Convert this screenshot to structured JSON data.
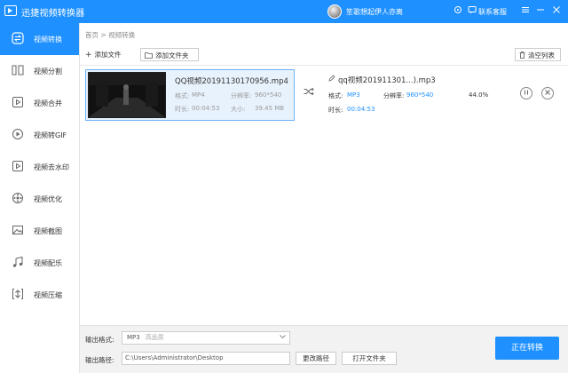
{
  "app": {
    "title": "迅捷视频转换器",
    "username": "笙歌想起伊人亦离",
    "support": "联系客服"
  },
  "titlebar_icons": [
    "skin-icon",
    "menu-icon",
    "minimize-icon",
    "close-icon"
  ],
  "sidebar": {
    "items": [
      {
        "label": "视频转换",
        "icon": "convert-icon",
        "active": true
      },
      {
        "label": "视频分割",
        "icon": "split-icon"
      },
      {
        "label": "视频合并",
        "icon": "merge-icon"
      },
      {
        "label": "视频转GIF",
        "icon": "gif-icon"
      },
      {
        "label": "视频去水印",
        "icon": "watermark-icon"
      },
      {
        "label": "视频优化",
        "icon": "optimize-icon"
      },
      {
        "label": "视频截图",
        "icon": "screenshot-icon"
      },
      {
        "label": "视频配乐",
        "icon": "music-icon"
      },
      {
        "label": "视频压缩",
        "icon": "compress-icon"
      }
    ]
  },
  "breadcrumb": {
    "home": "首页",
    "sep": ">",
    "current": "视频转换"
  },
  "toolbar": {
    "add_file": "添加文件",
    "add_folder": "添加文件夹",
    "clear_list": "清空列表"
  },
  "file": {
    "name": "QQ视频20191130170956.mp4",
    "format_label": "格式:",
    "format": "MP4",
    "resolution_label": "分辨率:",
    "resolution": "960*540",
    "duration_label": "时长:",
    "duration": "00:04:53",
    "size_label": "大小:",
    "size": "39.45 MB"
  },
  "output": {
    "name": "qq视频201911301...).mp3",
    "format_label": "格式:",
    "format": "MP3",
    "resolution_label": "分辨率:",
    "resolution": "960*540",
    "duration_label": "时长:",
    "duration": "00:04:53",
    "progress_text": "44.0%",
    "progress": 0.44
  },
  "bottom": {
    "format_label": "输出格式:",
    "format_value": "MP3",
    "format_quality": "高品质",
    "path_label": "输出路径:",
    "path_value": "C:\\Users\\Administrator\\Desktop",
    "change_path": "更改路径",
    "open_folder": "打开文件夹",
    "convert": "正在转换"
  },
  "colors": {
    "accent": "#1e90ff"
  }
}
